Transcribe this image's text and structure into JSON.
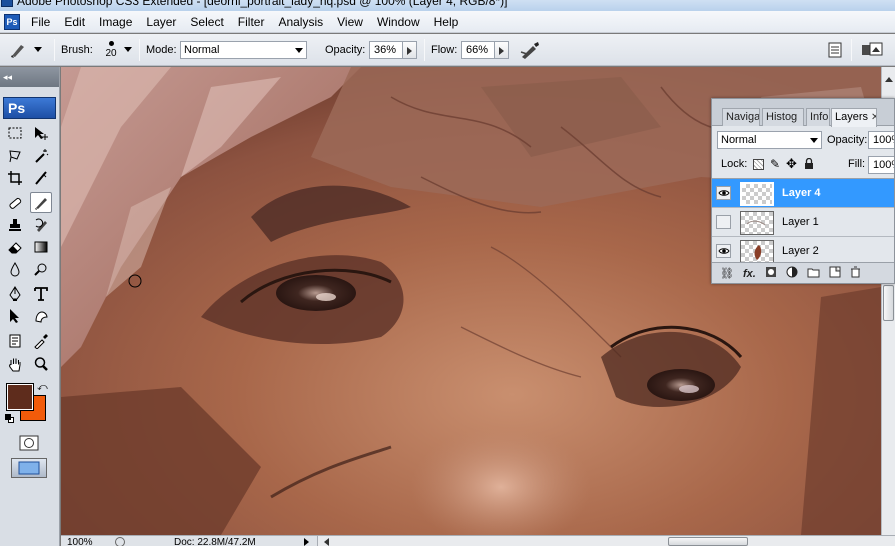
{
  "window": {
    "title": "Adobe Photoshop CS3 Extended - [deorni_portrait_lady_hq.psd @ 100% (Layer 4, RGB/8*)]"
  },
  "menu": {
    "logo": "Ps",
    "items": [
      "File",
      "Edit",
      "Image",
      "Layer",
      "Select",
      "Filter",
      "Analysis",
      "View",
      "Window",
      "Help"
    ]
  },
  "options": {
    "brush_label": "Brush:",
    "brush_size": "20",
    "mode_label": "Mode:",
    "mode_value": "Normal",
    "opacity_label": "Opacity:",
    "opacity_value": "36%",
    "flow_label": "Flow:",
    "flow_value": "66%"
  },
  "toolbox": {
    "collapse_glyph": "◂◂",
    "logo": "Ps",
    "foreground_color": "#5e2c1c",
    "background_color": "#f25b0a"
  },
  "layers_panel": {
    "tabs": [
      {
        "label": "Naviga"
      },
      {
        "label": "Histog"
      },
      {
        "label": "Info"
      },
      {
        "label": "Layers",
        "active": true
      }
    ],
    "blend_mode": "Normal",
    "opacity_label": "Opacity:",
    "opacity_value": "100%",
    "lock_label": "Lock:",
    "fill_label": "Fill:",
    "fill_value": "100%",
    "layers": [
      {
        "name": "Layer 4",
        "visible": true,
        "selected": true
      },
      {
        "name": "Layer 1",
        "visible": false,
        "selected": false
      },
      {
        "name": "Layer 2",
        "visible": true,
        "selected": false
      }
    ],
    "footer_icons": [
      "link-icon",
      "fx-icon",
      "mask-icon",
      "adjustment-icon",
      "group-folder-icon",
      "new-layer-icon",
      "trash-icon"
    ],
    "fx_label": "fx."
  },
  "statusbar": {
    "zoom": "100%",
    "doc": "Doc: 22.8M/47.2M"
  },
  "canvas": {
    "image": "portrait painting detail of eyes"
  }
}
